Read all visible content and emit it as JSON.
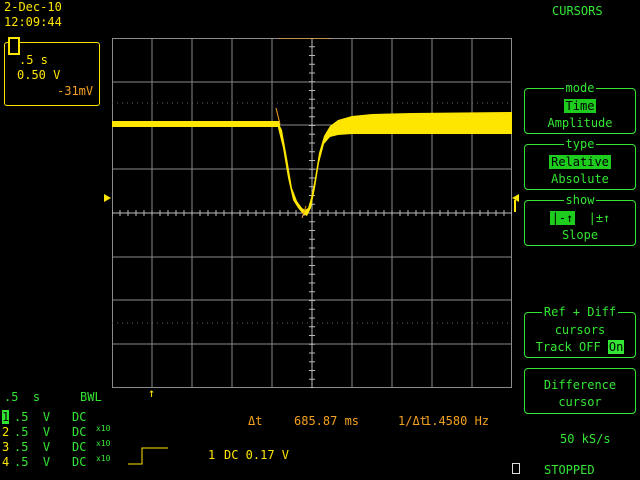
{
  "header": {
    "date": "2-Dec-10",
    "time": "12:09:44",
    "menu_title": "CURSORS"
  },
  "trigger_box": {
    "timebase": ".5 s",
    "volts": "0.50 V",
    "offset": "-31mV"
  },
  "panels": {
    "mode": {
      "title": "mode",
      "options": [
        "Time",
        "Amplitude"
      ],
      "selected": 0
    },
    "type": {
      "title": "type",
      "options": [
        "Relative",
        "Absolute"
      ],
      "selected": 0
    },
    "show": {
      "title": "show",
      "label": "Slope",
      "option_a": "|-↑",
      "option_b": "|±↑"
    },
    "ref_diff": {
      "title": "Ref + Diff",
      "line1": "cursors",
      "line2_prefix": "Track OFF",
      "line2_selected": "On"
    },
    "difference": {
      "line1": "Difference",
      "line2": "cursor"
    }
  },
  "bottom_left": {
    "timebase": ".5  s",
    "bwl": "BWL",
    "channels": [
      {
        "num": "1",
        "volts": ".5  V",
        "coupling": "DC",
        "probe": ""
      },
      {
        "num": "2",
        "volts": ".5  V",
        "coupling": "DC",
        "probe": "x10"
      },
      {
        "num": "3",
        "volts": ".5  V",
        "coupling": "DC",
        "probe": "x10"
      },
      {
        "num": "4",
        "volts": ".5  V",
        "coupling": "DC",
        "probe": "x10"
      }
    ]
  },
  "measurement": {
    "delta_t_label": "Δt",
    "delta_t_value": "685.87 ms",
    "freq_label": "1/Δt",
    "freq_value": "1.4580 Hz"
  },
  "trigger_info": {
    "channel": "1",
    "text": "DC 0.17 V"
  },
  "status": {
    "sample_rate": "50 kS/s",
    "state": "STOPPED"
  },
  "colors": {
    "trace": "#ffe600",
    "menu": "#33e633",
    "grid": "#8a8a8a",
    "cursor": "#f2a020"
  }
}
